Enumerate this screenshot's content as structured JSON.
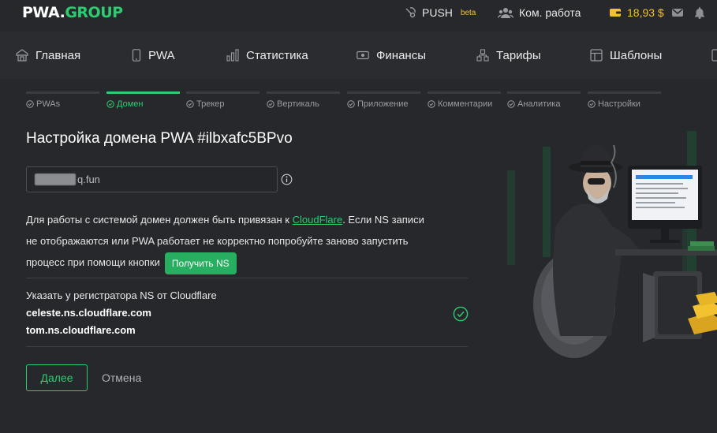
{
  "brand": {
    "logo_left": "PWA.",
    "logo_right": "GROUP"
  },
  "topbar": {
    "push_label": "PUSH",
    "push_badge": "beta",
    "team_label": "Ком. работа",
    "balance": "18,93 $",
    "icons": [
      "push-icon",
      "team-icon",
      "wallet-icon",
      "mail-icon",
      "bell-icon"
    ]
  },
  "nav": {
    "items": [
      {
        "label": "Главная",
        "icon": "home-icon"
      },
      {
        "label": "PWA",
        "icon": "phone-icon"
      },
      {
        "label": "Статистика",
        "icon": "chart-icon"
      },
      {
        "label": "Финансы",
        "icon": "money-icon"
      },
      {
        "label": "Тарифы",
        "icon": "tiers-icon"
      },
      {
        "label": "Шаблоны",
        "icon": "template-icon"
      }
    ]
  },
  "steps": [
    {
      "label": "PWAs",
      "active": false
    },
    {
      "label": "Домен",
      "active": true
    },
    {
      "label": "Трекер",
      "active": false
    },
    {
      "label": "Вертикаль",
      "active": false
    },
    {
      "label": "Приложение",
      "active": false
    },
    {
      "label": "Комментарии",
      "active": false
    },
    {
      "label": "Аналитика",
      "active": false
    },
    {
      "label": "Настройки",
      "active": false
    }
  ],
  "page": {
    "title": "Настройка домена PWA #ilbxafc5BPvo",
    "domain_value": "q.fun",
    "desc_part1": "Для работы с системой домен должен быть привязан к ",
    "desc_link": "CloudFlare",
    "desc_part2": ". Если NS записи не отображаются или PWA работает не корректно попробуйте заново запустить процесс при помощи кнопки",
    "get_ns_button": "Получить NS",
    "ns_label": "Указать у регистратора NS от Cloudflare",
    "ns_servers": [
      "celeste.ns.cloudflare.com",
      "tom.ns.cloudflare.com"
    ],
    "next_button": "Далее",
    "cancel_button": "Отмена"
  },
  "colors": {
    "accent": "#2ecc71",
    "background": "#26282b",
    "nav": "#2a2c30",
    "balance": "#f2c230"
  }
}
